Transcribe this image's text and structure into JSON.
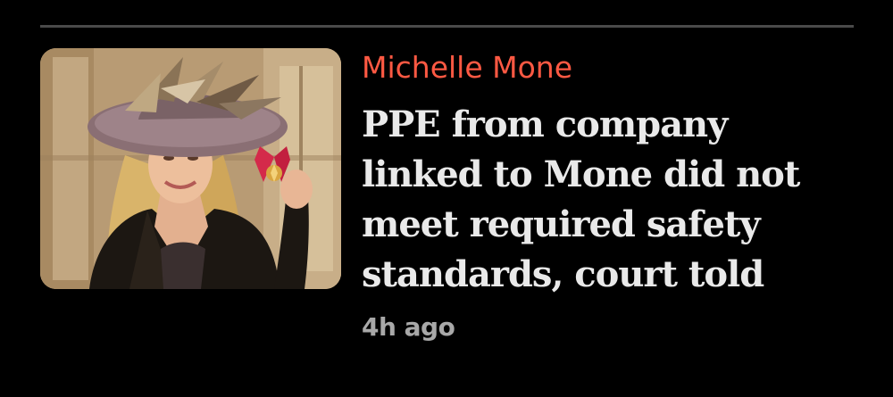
{
  "article": {
    "kicker": "Michelle Mone",
    "headline_lines": [
      "PPE from company",
      "linked to Mone did not",
      "meet required safety",
      "standards, court told"
    ],
    "timestamp": "4h ago",
    "image_subject": "woman in feathered hat holding medal"
  },
  "colors": {
    "background": "#000000",
    "kicker": "#ff5943",
    "headline": "#e9e9e9",
    "timestamp": "#a8a8a8",
    "divider": "#4a4a4a"
  }
}
